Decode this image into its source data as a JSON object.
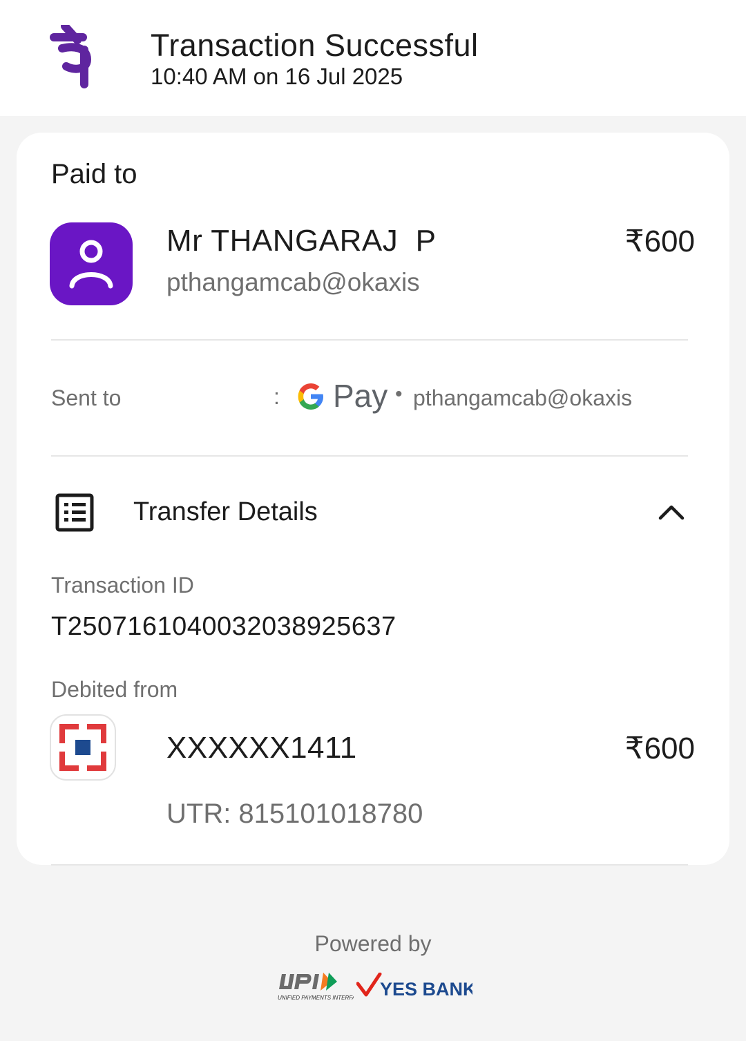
{
  "header": {
    "title": "Transaction Successful",
    "time": "10:40 AM on 16 Jul 2025",
    "logo": "phonepe-logo"
  },
  "paid_to": {
    "label": "Paid to",
    "name": "Mr THANGARAJ  P",
    "vpa": "pthangamcab@okaxis",
    "amount": "₹600",
    "avatar_icon": "person-icon",
    "avatar_color": "#6a16c5"
  },
  "sent_to": {
    "label": "Sent to",
    "separator": ":",
    "app_name": "Pay",
    "dot": "•",
    "vpa": "pthangamcab@okaxis"
  },
  "transfer_details": {
    "title": "Transfer Details",
    "icon": "receipt-list-icon",
    "expanded": true,
    "transaction_id_label": "Transaction ID",
    "transaction_id": "T2507161040032038925637",
    "debited_from_label": "Debited from",
    "account": "XXXXXX1411",
    "amount": "₹600",
    "utr": "UTR: 815101018780",
    "bank_logo": "hdfc-bank-logo"
  },
  "footer": {
    "powered_by": "Powered by",
    "upi_logo": "upi-logo",
    "partner_bank": "YES BANK"
  },
  "colors": {
    "brand_purple": "#5f259f",
    "avatar_purple": "#6a16c5",
    "bank_red": "#e03a3c",
    "bank_blue": "#1d4a8f"
  }
}
